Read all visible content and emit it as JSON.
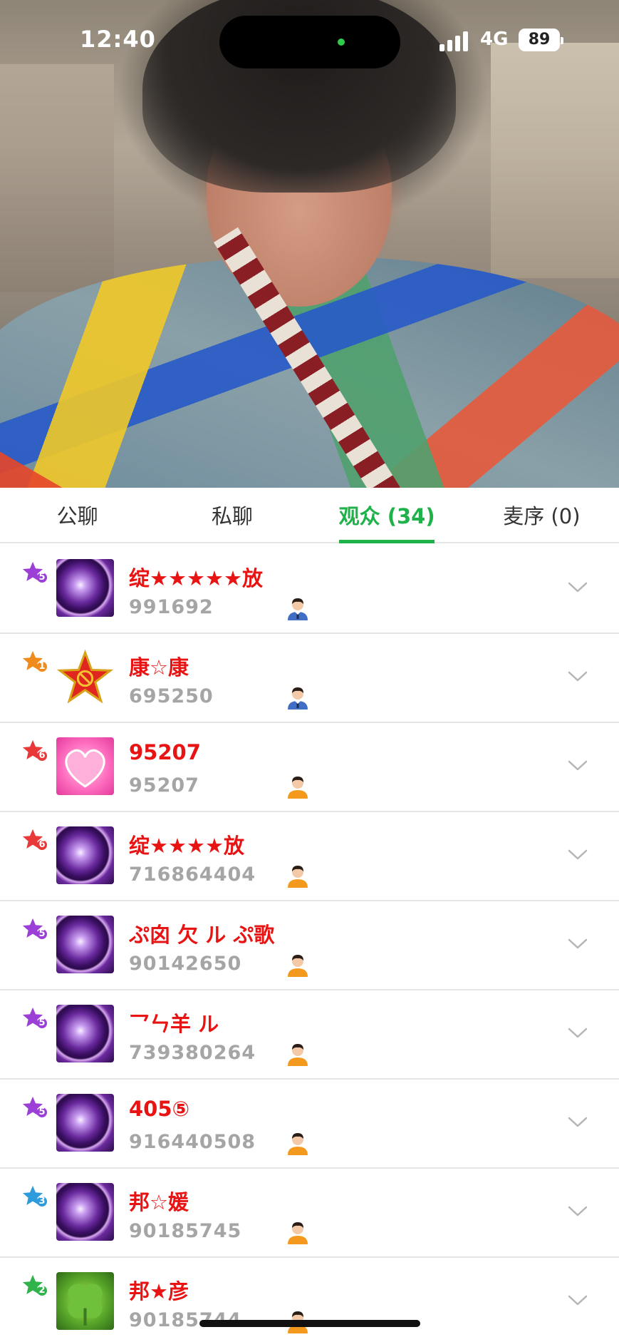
{
  "status_bar": {
    "time": "12:40",
    "network": "4G",
    "battery": "89"
  },
  "tabs": [
    {
      "label": "公聊",
      "active": false
    },
    {
      "label": "私聊",
      "active": false
    },
    {
      "label": "观众 (34)",
      "active": true
    },
    {
      "label": "麦序 (0)",
      "active": false
    }
  ],
  "colors": {
    "accent": "#1fb24a",
    "name": "#e81414",
    "uid": "#a5a5a5"
  },
  "audience": [
    {
      "name": "绽★★★★★放",
      "uid": "991692",
      "level": "5",
      "badge_color": "#9b3fd6",
      "avatar": "eclipse-avatar",
      "person": "suit-person-icon"
    },
    {
      "name": "康☆康",
      "uid": "695250",
      "level": "1",
      "badge_color": "#f08a1a",
      "avatar": "red-star-avatar",
      "person": "suit-person-icon"
    },
    {
      "name": "95207",
      "uid": "95207",
      "level": "6",
      "badge_color": "#e83838",
      "avatar": "love-heart-avatar",
      "person": "person-icon"
    },
    {
      "name": "绽★★★★放",
      "uid": "716864404",
      "level": "6",
      "badge_color": "#e83838",
      "avatar": "eclipse-avatar",
      "person": "person-icon"
    },
    {
      "name": "ぷ囟  欠 ル ぷ歌",
      "uid": "90142650",
      "level": "5",
      "badge_color": "#9b3fd6",
      "avatar": "eclipse-avatar",
      "person": "person-icon"
    },
    {
      "name": "乛ㄣ羊 ル",
      "uid": "739380264",
      "level": "5",
      "badge_color": "#9b3fd6",
      "avatar": "eclipse-avatar",
      "person": "person-icon"
    },
    {
      "name": "405⑤",
      "uid": "916440508",
      "level": "5",
      "badge_color": "#9b3fd6",
      "avatar": "eclipse-avatar",
      "person": "person-icon"
    },
    {
      "name": "邦☆媛",
      "uid": "90185745",
      "level": "3",
      "badge_color": "#2e9bdc",
      "avatar": "eclipse-avatar",
      "person": "person-icon"
    },
    {
      "name": "邦★彦",
      "uid": "90185744",
      "level": "2",
      "badge_color": "#2fb34a",
      "avatar": "clover-avatar",
      "person": "person-icon"
    }
  ]
}
